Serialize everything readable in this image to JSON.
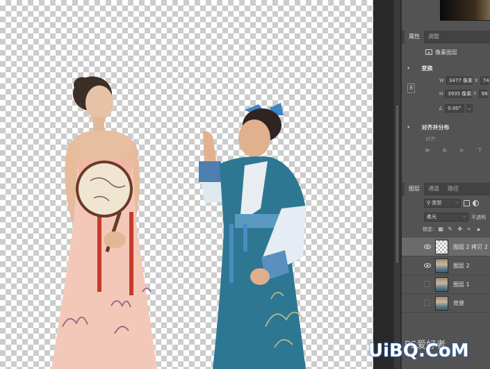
{
  "properties_panel": {
    "tabs": [
      "属性",
      "调整"
    ],
    "layer_type": "像素图层",
    "transform_title": "变换",
    "width_label": "W",
    "width_value": "3477 像素",
    "height_label": "H",
    "height_value": "3935 像素",
    "x_label": "X",
    "x_value": "74",
    "y_label": "Y",
    "y_value": "98",
    "angle_value": "0.00°",
    "align_title": "对齐并分布",
    "align_label": "对齐:"
  },
  "layers_panel": {
    "tabs": [
      "图层",
      "通道",
      "路径"
    ],
    "filter_kind": "类型",
    "blend_mode": "柔光",
    "opacity_label": "不透明",
    "lock_label": "锁定:",
    "layers": [
      {
        "name": "图层 2 拷贝 2",
        "visible": true,
        "selected": true,
        "thumb": "transparent"
      },
      {
        "name": "图层 2",
        "visible": true,
        "selected": false,
        "thumb": "photo"
      },
      {
        "name": "图层 1",
        "visible": false,
        "selected": false,
        "thumb": "photo"
      },
      {
        "name": "背景",
        "visible": false,
        "selected": false,
        "thumb": "photo"
      }
    ]
  },
  "watermark": {
    "logo": "UiBQ.CoM",
    "chinese": "PS爱好者"
  }
}
